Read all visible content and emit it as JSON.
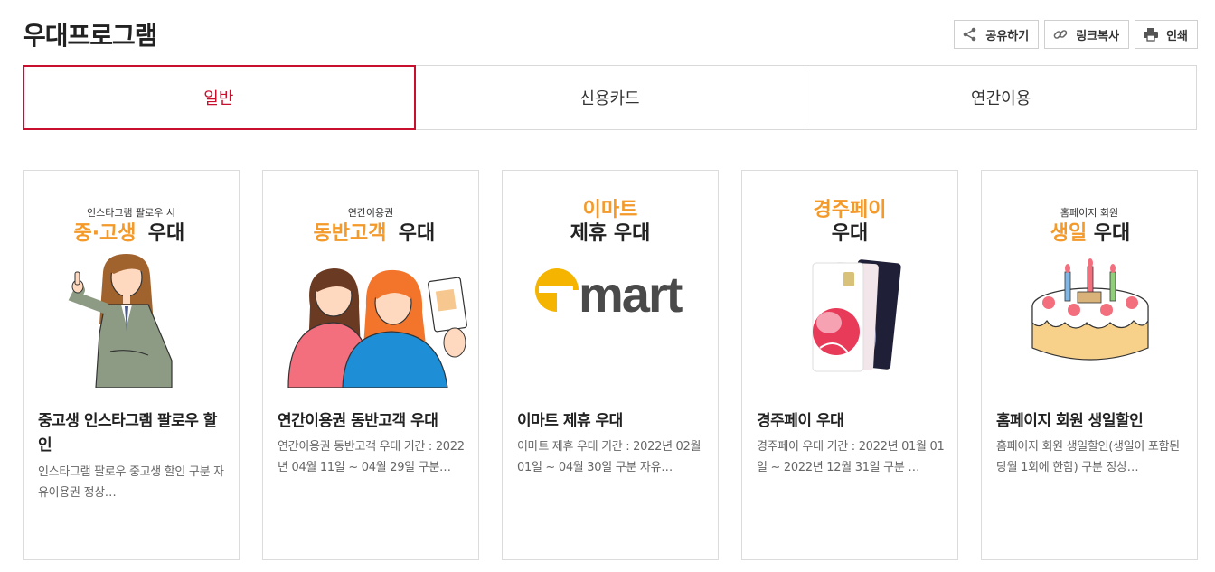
{
  "page": {
    "title": "우대프로그램"
  },
  "actions": {
    "share": "공유하기",
    "link_copy": "링크복사",
    "print": "인쇄"
  },
  "tabs": [
    {
      "label": "일반",
      "active": true
    },
    {
      "label": "신용카드",
      "active": false
    },
    {
      "label": "연간이용",
      "active": false
    }
  ],
  "colors": {
    "accent": "#c8102e",
    "orange": "#f39a2b",
    "emart_yellow": "#f5b400",
    "emart_gray": "#4a4a4a"
  },
  "cards": [
    {
      "banner_small": "인스타그램 팔로우 시",
      "banner_big_orange": "중·고생",
      "banner_big_dark": "우대",
      "title": "중고생 인스타그램 팔로우 할인",
      "desc": "인스타그램 팔로우 중고생 할인 구분 자유이용권 정상…"
    },
    {
      "banner_small": "연간이용권",
      "banner_big_orange": "동반고객",
      "banner_big_dark": "우대",
      "title": "연간이용권 동반고객 우대",
      "desc": "연간이용권 동반고객 우대 기간 : 2022년 04월 11일 ~ 04월 29일 구분…"
    },
    {
      "banner_line1": "이마트",
      "banner_line2": "제휴 우대",
      "logo_text": "emart",
      "title": "이마트 제휴 우대",
      "desc": "이마트 제휴 우대 기간 : 2022년 02월 01일 ~ 04월 30일 구분 자유…"
    },
    {
      "banner_line1": "경주페이",
      "banner_line2": "우대",
      "title": "경주페이 우대",
      "desc": "경주페이 우대 기간 : 2022년 01월 01일 ~ 2022년 12월 31일 구분 …"
    },
    {
      "banner_small": "홈페이지 회원",
      "banner_big_orange": "생일",
      "banner_big_dark": "우대",
      "title": "홈페이지 회원 생일할인",
      "desc": "홈페이지 회원 생일할인(생일이 포함된 당월 1회에 한함) 구분 정상…"
    }
  ]
}
